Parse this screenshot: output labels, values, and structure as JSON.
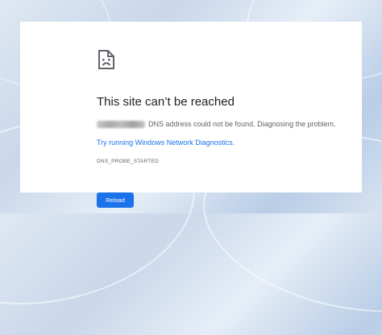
{
  "error_page": {
    "title": "This site can’t be reached",
    "message": "DNS address could not be found. Diagnosing the problem.",
    "diagnostics_link": "Try running Windows Network Diagnostics.",
    "error_code": "DNS_PROBE_STARTED",
    "reload_label": "Reload",
    "icon": "sad-page-icon"
  },
  "colors": {
    "title": "#202124",
    "text": "#5f6368",
    "link": "#1a73e8",
    "button": "#1a73e8",
    "button_text": "#ffffff",
    "panel": "#ffffff"
  }
}
